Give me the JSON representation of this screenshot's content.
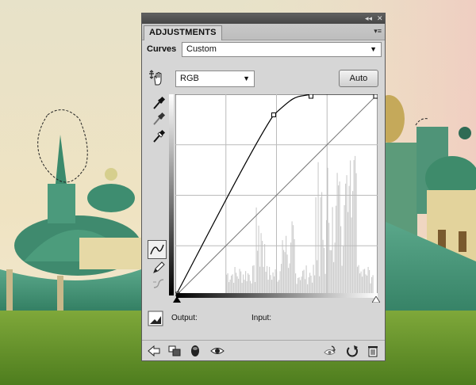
{
  "panel": {
    "tab_label": "ADJUSTMENTS",
    "title_collapse": "◂◂",
    "title_close": "✕",
    "menu_icon": "▾≡"
  },
  "curves": {
    "label": "Curves",
    "preset_value": "Custom",
    "channel_value": "RGB",
    "auto_label": "Auto"
  },
  "curve_points": [
    [
      0,
      0
    ],
    [
      124,
      229
    ],
    [
      171,
      255
    ],
    [
      255,
      255
    ]
  ],
  "footer": {
    "output_label": "Output:",
    "input_label": "Input:"
  },
  "icons": {
    "hand": "on-image-adjust-hand-icon",
    "eyedropper_black": "black-point-eyedropper-icon",
    "eyedropper_gray": "gray-point-eyedropper-icon",
    "eyedropper_white": "white-point-eyedropper-icon",
    "curve_mode": "curve-point-mode-icon",
    "pencil": "pencil-draw-icon",
    "smooth": "smooth-curve-icon",
    "clipping": "show-clipping-icon"
  },
  "colors": {
    "panel_bg": "#d6d6d6",
    "title_strip": "#464646",
    "graph_bg": "#ffffff",
    "histogram": "#cfcfcf"
  }
}
